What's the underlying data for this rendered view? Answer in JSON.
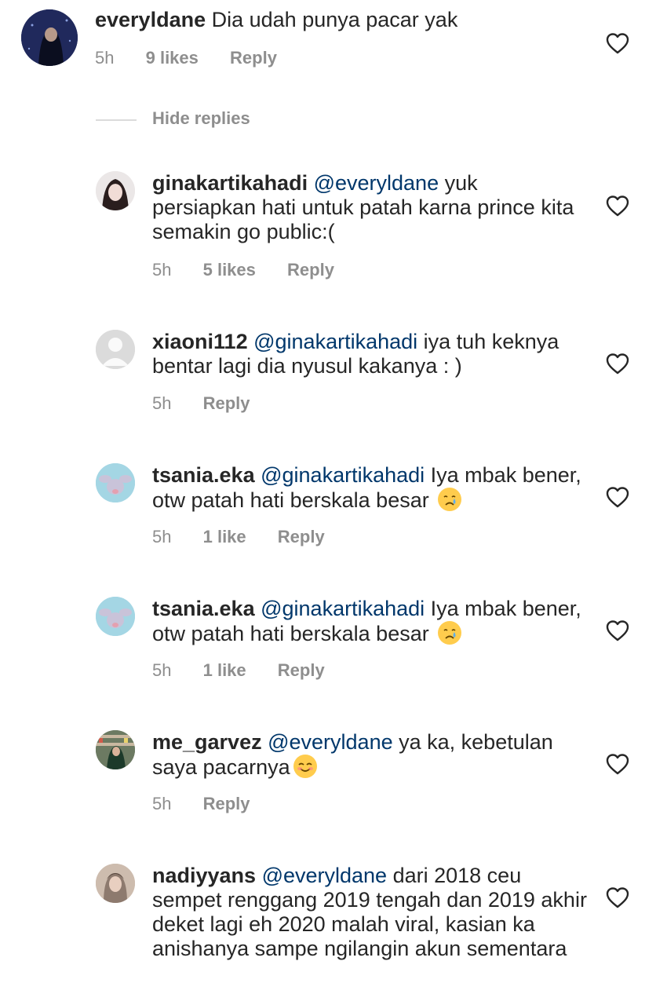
{
  "comments": [
    {
      "username": "everyldane",
      "mention": "",
      "text": "Dia udah punya pacar yak",
      "time": "5h",
      "likes": "9 likes",
      "reply": "Reply"
    },
    {
      "username": "ginakartikahadi",
      "mention": "@everyldane",
      "text": "yuk persiapkan hati untuk patah karna prince kita semakin go public:(",
      "time": "5h",
      "likes": "5 likes",
      "reply": "Reply"
    },
    {
      "username": "xiaoni112",
      "mention": "@ginakartikahadi",
      "text": "iya tuh keknya bentar lagi dia nyusul kakanya : )",
      "time": "5h",
      "likes": "",
      "reply": "Reply"
    },
    {
      "username": "tsania.eka",
      "mention": "@ginakartikahadi",
      "text": "Iya mbak bener, otw patah hati berskala besar",
      "time": "5h",
      "likes": "1 like",
      "reply": "Reply"
    },
    {
      "username": "tsania.eka",
      "mention": "@ginakartikahadi",
      "text": "Iya mbak bener, otw patah hati berskala besar",
      "time": "5h",
      "likes": "1 like",
      "reply": "Reply"
    },
    {
      "username": "me_garvez",
      "mention": "@everyldane",
      "text": "ya ka, kebetulan saya pacarnya",
      "time": "5h",
      "likes": "",
      "reply": "Reply"
    },
    {
      "username": "nadiyyans",
      "mention": "@everyldane",
      "text": "dari 2018 ceu sempet renggang 2019 tengah dan 2019 akhir deket lagi eh 2020 malah viral, kasian ka anishanya sampe ngilangin akun sementara",
      "time": "",
      "likes": "",
      "reply": ""
    }
  ],
  "hide_replies_label": "Hide replies",
  "icons": {
    "like": "heart-outline-icon",
    "crying_emoji": "crying-face-emoji",
    "smiling_emoji": "smiling-face-emoji"
  },
  "colors": {
    "text": "#262626",
    "mention": "#00376b",
    "secondary": "#8e8e8e",
    "divider": "#dbdbdb"
  }
}
